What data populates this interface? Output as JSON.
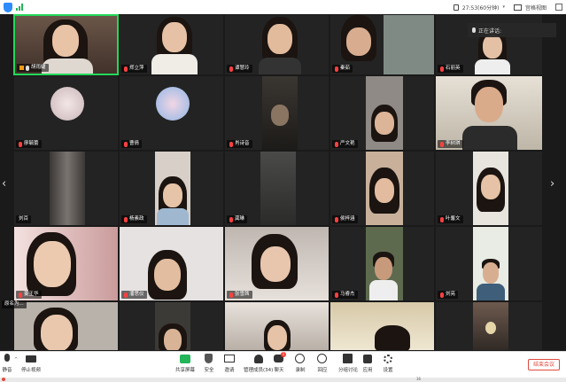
{
  "topbar": {
    "timer": "27:53(60分钟)",
    "view_label": "宫格视图"
  },
  "speaking": "正在讲话:",
  "tiles": [
    {
      "name": "胡雨婕",
      "mic": "on",
      "host": true
    },
    {
      "name": "郑立萍",
      "mic": "off"
    },
    {
      "name": "谭慧玲",
      "mic": "off"
    },
    {
      "name": "秦茹",
      "mic": "off"
    },
    {
      "name": "石丽英",
      "mic": "off"
    },
    {
      "name": "廖毓蕾",
      "mic": "off"
    },
    {
      "name": "曹倩",
      "mic": "off"
    },
    {
      "name": "肖诗音",
      "mic": "off"
    },
    {
      "name": "严文艳",
      "mic": "off"
    },
    {
      "name": "李树琪",
      "mic": "off"
    },
    {
      "name": "刘百",
      "mic": "none"
    },
    {
      "name": "杨素政",
      "mic": "off"
    },
    {
      "name": "龚琳",
      "mic": "off"
    },
    {
      "name": "侯梓涵",
      "mic": "off"
    },
    {
      "name": "叶馨文",
      "mic": "off"
    },
    {
      "name": "姜王华",
      "mic": "off"
    },
    {
      "name": "潘思仪",
      "mic": "off"
    },
    {
      "name": "张雪茜",
      "mic": "off"
    },
    {
      "name": "马睿杰",
      "mic": "off"
    },
    {
      "name": "刘亮",
      "mic": "off"
    }
  ],
  "overlay_label": "原名为...",
  "toolbar": {
    "mute": "静音",
    "stop_video": "停止视频",
    "share": "共享屏幕",
    "security": "安全",
    "invite": "邀请",
    "participants": "管理成员(34)",
    "chat": "聊天",
    "chat_badge": "1",
    "record": "录制",
    "reactions": "回应",
    "breakout": "分组讨论",
    "apps": "应用",
    "settings": "设置",
    "end": "结束会议"
  },
  "status": {
    "num": "36"
  },
  "colors": {
    "active_border": "#23d959",
    "end_red": "#e04a3f",
    "share_green": "#23b559",
    "accent_blue": "#2d8cff"
  }
}
